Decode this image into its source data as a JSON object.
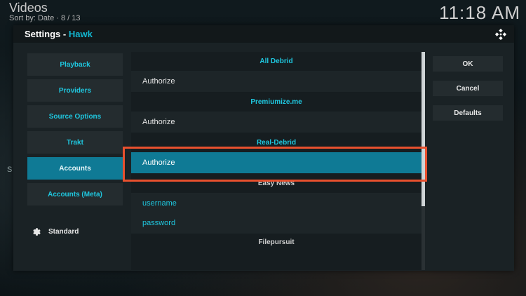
{
  "background": {
    "title": "Videos",
    "sort_info": "Sort by: Date  ·  8 / 13",
    "clock": "11:18 AM",
    "side_letter": "S"
  },
  "dialog": {
    "title_prefix": "Settings - ",
    "title_addon": "Hawk",
    "logo_icon": "kodi-logo-icon"
  },
  "categories": [
    {
      "label": "Playback"
    },
    {
      "label": "Providers"
    },
    {
      "label": "Source Options"
    },
    {
      "label": "Trakt"
    },
    {
      "label": "Accounts",
      "active": true
    },
    {
      "label": "Accounts (Meta)"
    }
  ],
  "settings_level": {
    "icon": "gear-icon",
    "label": "Standard"
  },
  "settings_list": {
    "all_debrid_header": "All Debrid",
    "all_debrid_authorize": "Authorize",
    "premiumize_header": "Premiumize.me",
    "premiumize_authorize": "Authorize",
    "realdebrid_header": "Real-Debrid",
    "realdebrid_authorize": "Authorize",
    "easynews_header": "Easy News",
    "easynews_username": "username",
    "easynews_password": "password",
    "filepursuit_header": "Filepursuit"
  },
  "actions": {
    "ok": "OK",
    "cancel": "Cancel",
    "defaults": "Defaults"
  },
  "colors": {
    "accent": "#12b5cf",
    "selected": "#0f7a95",
    "highlight_box": "#e8502e"
  }
}
